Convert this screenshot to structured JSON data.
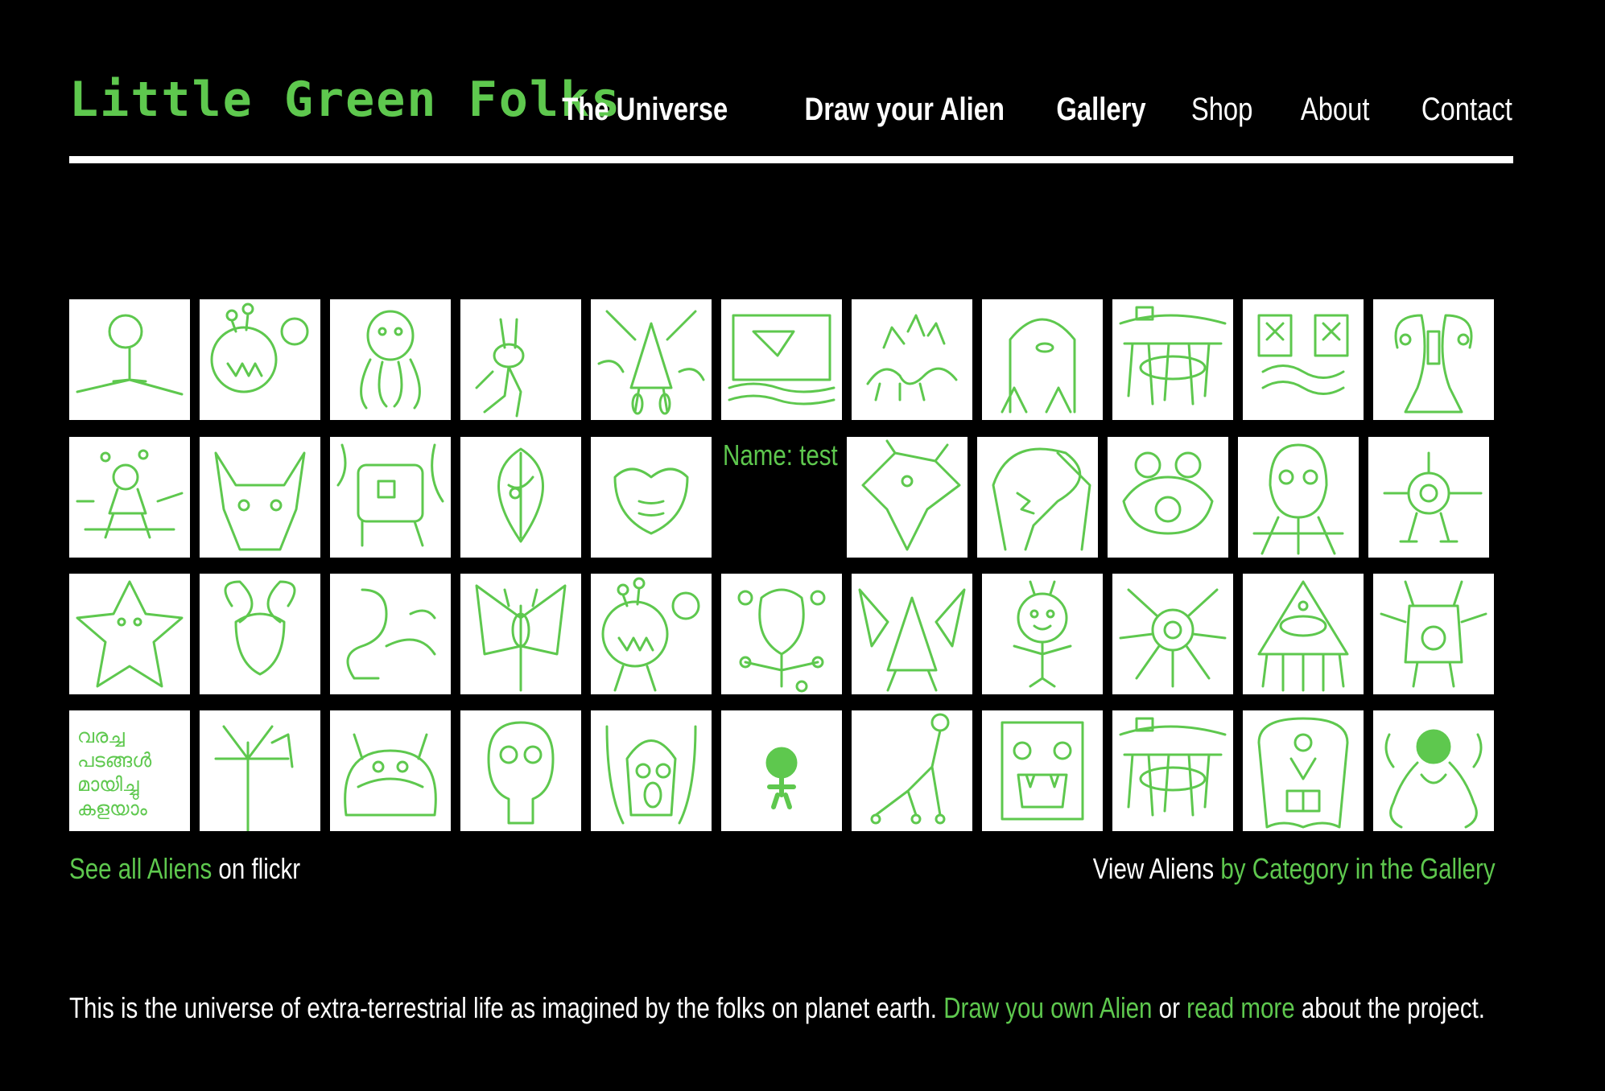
{
  "site": {
    "logo": "Little Green Folks"
  },
  "nav": [
    {
      "label": "The Universe",
      "bold": true
    },
    {
      "label": "Draw your Alien",
      "bold": true
    },
    {
      "label": "Gallery",
      "bold": true
    },
    {
      "label": "Shop",
      "bold": false
    },
    {
      "label": "About",
      "bold": false
    },
    {
      "label": "Contact",
      "bold": false
    }
  ],
  "gallery": {
    "hover_label": "Name: test",
    "rows": [
      [
        "stick-figure-alien",
        "antenna-blob-alien",
        "octopus-alien",
        "bunny-ear-alien",
        "triangle-legs-alien",
        "landscape-drawing",
        "multi-head-creature",
        "one-eye-blob",
        "island-scene",
        "cross-eyes-alien",
        "tall-eyes-alien"
      ],
      [
        "spider-stick-alien",
        "horned-mask-alien",
        "scribble-alien",
        "leaf-face-alien",
        "heart-face-alien",
        "__hover__",
        "horned-beast",
        "big-head-monster",
        "frog-alien",
        "tall-monster",
        "cyclops-star-alien"
      ],
      [
        "star-person",
        "winged-face",
        "snake-alien",
        "butterfly-alien",
        "antenna-blob-alien-2",
        "bulb-antenna-alien",
        "bat-alien",
        "smiling-alien",
        "sun-eye-alien",
        "pyramid-alien",
        "peace-robot"
      ],
      [
        "malayalam-text",
        "stick-tree",
        "hairy-monster",
        "skull-face",
        "screaming-ghost",
        "tiny-skull",
        "balloon-walker",
        "box-monster",
        "island-scene-2",
        "tooth-ghost",
        "curly-arm-alien"
      ]
    ]
  },
  "links": {
    "left_link": "See all Aliens",
    "left_suffix": " on flickr",
    "right_prefix": "View Aliens ",
    "right_link": "by Category in the Gallery"
  },
  "footer": {
    "text": "This is the universe of extra-terrestrial life as imagined by the folks on planet earth. ",
    "link1": "Draw you own Alien",
    "mid": " or ",
    "link2": "read more",
    "end": " about the project."
  },
  "colors": {
    "accent": "#5ec84e",
    "background": "#000000",
    "text": "#ffffff"
  }
}
